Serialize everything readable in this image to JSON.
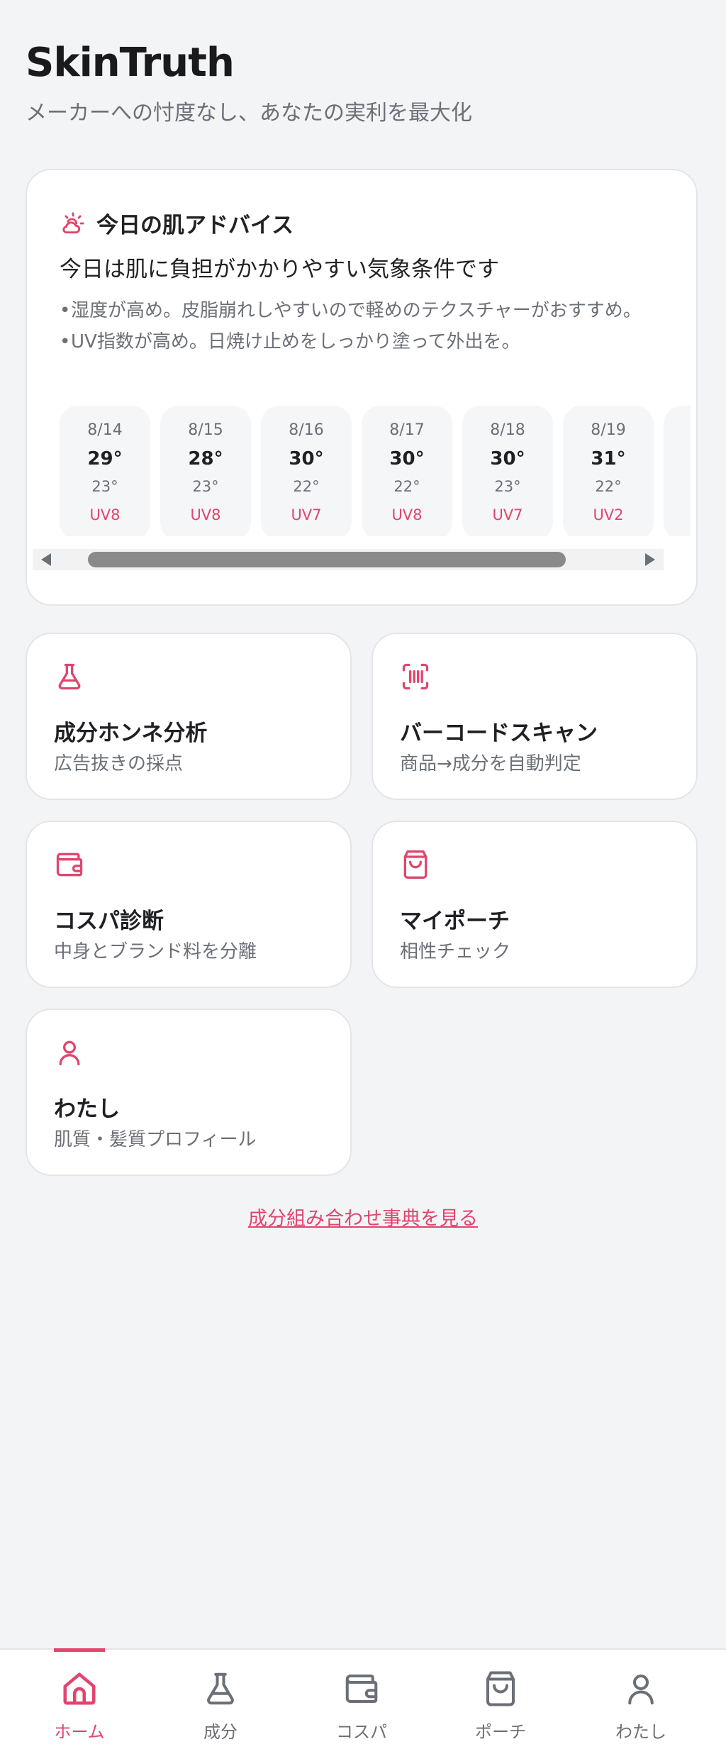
{
  "header": {
    "title": "SkinTruth",
    "subtitle": "メーカーへの忖度なし、あなたの実利を最大化"
  },
  "advice": {
    "icon": "sun-cloud-icon",
    "title": "今日の肌アドバイス",
    "headline": "今日は肌に負担がかかりやすい気象条件です",
    "bullets": [
      "湿度が高め。皮脂崩れしやすいので軽めのテクスチャーがおすすめ。",
      "UV指数が高め。日焼け止めをしっかり塗って外出を。"
    ],
    "forecast": [
      {
        "date": "8/14",
        "high": "29°",
        "low": "23°",
        "uv": "UV8"
      },
      {
        "date": "8/15",
        "high": "28°",
        "low": "23°",
        "uv": "UV8"
      },
      {
        "date": "8/16",
        "high": "30°",
        "low": "22°",
        "uv": "UV7"
      },
      {
        "date": "8/17",
        "high": "30°",
        "low": "22°",
        "uv": "UV8"
      },
      {
        "date": "8/18",
        "high": "30°",
        "low": "23°",
        "uv": "UV7"
      },
      {
        "date": "8/19",
        "high": "31°",
        "low": "22°",
        "uv": "UV2"
      },
      {
        "date": "",
        "high": "",
        "low": "",
        "uv": ""
      }
    ]
  },
  "tiles": [
    {
      "icon": "flask-icon",
      "title": "成分ホンネ分析",
      "sub": "広告抜きの採点"
    },
    {
      "icon": "barcode-scan-icon",
      "title": "バーコードスキャン",
      "sub": "商品→成分を自動判定"
    },
    {
      "icon": "wallet-icon",
      "title": "コスパ診断",
      "sub": "中身とブランド料を分離"
    },
    {
      "icon": "pouch-icon",
      "title": "マイポーチ",
      "sub": "相性チェック"
    },
    {
      "icon": "person-icon",
      "title": "わたし",
      "sub": "肌質・髪質プロフィール"
    }
  ],
  "dictionary_link": "成分組み合わせ事典を見る",
  "nav": [
    {
      "icon": "home-icon",
      "label": "ホーム",
      "active": true
    },
    {
      "icon": "flask-icon",
      "label": "成分",
      "active": false
    },
    {
      "icon": "wallet-icon",
      "label": "コスパ",
      "active": false
    },
    {
      "icon": "pouch-icon",
      "label": "ポーチ",
      "active": false
    },
    {
      "icon": "person-icon",
      "label": "わたし",
      "active": false
    }
  ],
  "colors": {
    "accent": "#e0456e",
    "background": "#f3f4f6",
    "card": "#ffffff",
    "muted": "#6b6f76"
  }
}
